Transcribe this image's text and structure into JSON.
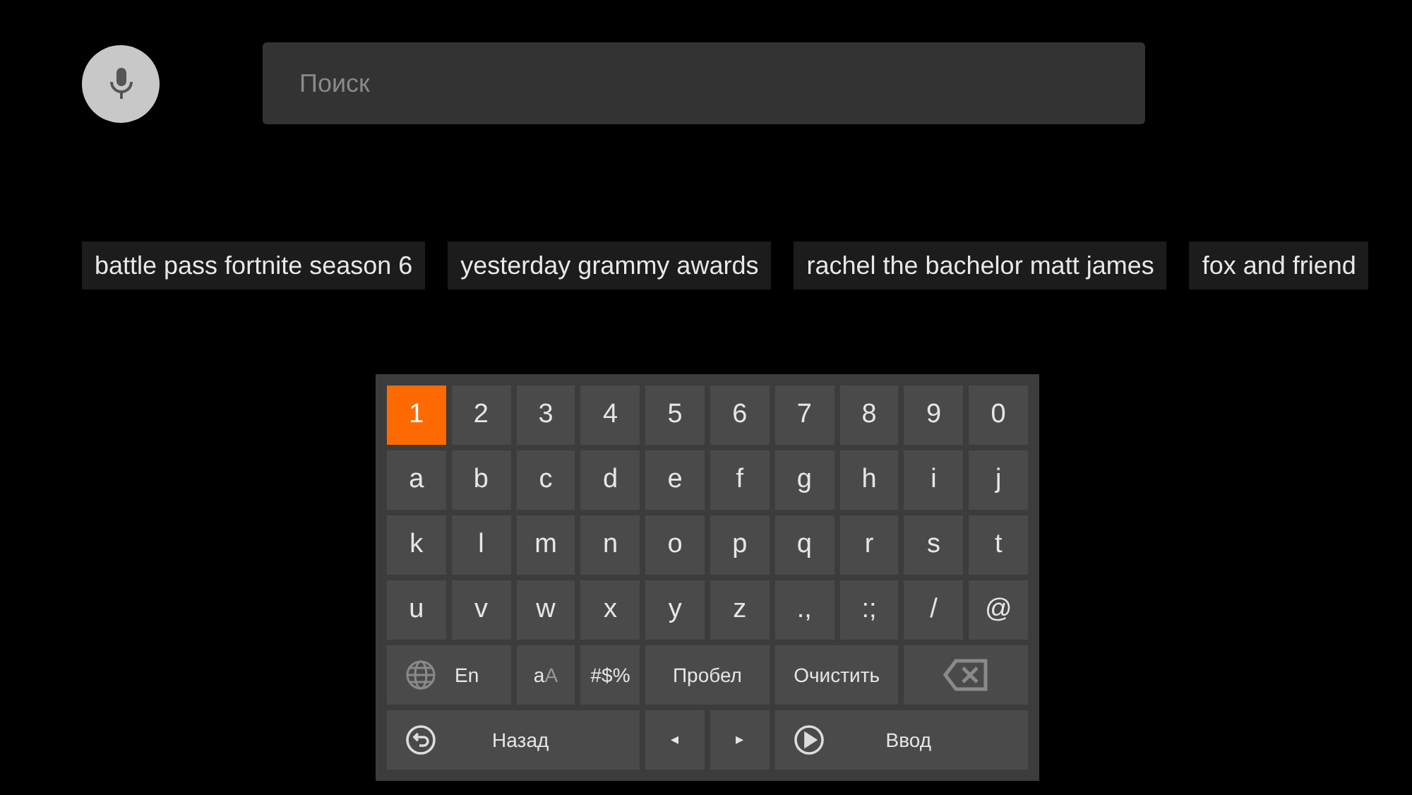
{
  "search": {
    "placeholder": "Поиск"
  },
  "suggestions": [
    "battle pass fortnite season 6",
    "yesterday grammy awards",
    "rachel the bachelor matt james",
    "fox and friend"
  ],
  "keyboard": {
    "keys": [
      {
        "kind": "char",
        "label": "1",
        "selected": true
      },
      {
        "kind": "char",
        "label": "2",
        "selected": false
      },
      {
        "kind": "char",
        "label": "3",
        "selected": false
      },
      {
        "kind": "char",
        "label": "4",
        "selected": false
      },
      {
        "kind": "char",
        "label": "5",
        "selected": false
      },
      {
        "kind": "char",
        "label": "6",
        "selected": false
      },
      {
        "kind": "char",
        "label": "7",
        "selected": false
      },
      {
        "kind": "char",
        "label": "8",
        "selected": false
      },
      {
        "kind": "char",
        "label": "9",
        "selected": false
      },
      {
        "kind": "char",
        "label": "0",
        "selected": false
      },
      {
        "kind": "char",
        "label": "a",
        "selected": false
      },
      {
        "kind": "char",
        "label": "b",
        "selected": false
      },
      {
        "kind": "char",
        "label": "c",
        "selected": false
      },
      {
        "kind": "char",
        "label": "d",
        "selected": false
      },
      {
        "kind": "char",
        "label": "e",
        "selected": false
      },
      {
        "kind": "char",
        "label": "f",
        "selected": false
      },
      {
        "kind": "char",
        "label": "g",
        "selected": false
      },
      {
        "kind": "char",
        "label": "h",
        "selected": false
      },
      {
        "kind": "char",
        "label": "i",
        "selected": false
      },
      {
        "kind": "char",
        "label": "j",
        "selected": false
      },
      {
        "kind": "char",
        "label": "k",
        "selected": false
      },
      {
        "kind": "char",
        "label": "l",
        "selected": false
      },
      {
        "kind": "char",
        "label": "m",
        "selected": false
      },
      {
        "kind": "char",
        "label": "n",
        "selected": false
      },
      {
        "kind": "char",
        "label": "o",
        "selected": false
      },
      {
        "kind": "char",
        "label": "p",
        "selected": false
      },
      {
        "kind": "char",
        "label": "q",
        "selected": false
      },
      {
        "kind": "char",
        "label": "r",
        "selected": false
      },
      {
        "kind": "char",
        "label": "s",
        "selected": false
      },
      {
        "kind": "char",
        "label": "t",
        "selected": false
      },
      {
        "kind": "char",
        "label": "u",
        "selected": false
      },
      {
        "kind": "char",
        "label": "v",
        "selected": false
      },
      {
        "kind": "char",
        "label": "w",
        "selected": false
      },
      {
        "kind": "char",
        "label": "x",
        "selected": false
      },
      {
        "kind": "char",
        "label": "y",
        "selected": false
      },
      {
        "kind": "char",
        "label": "z",
        "selected": false
      },
      {
        "kind": "char",
        "label": ".,",
        "selected": false
      },
      {
        "kind": "char",
        "label": ":;",
        "selected": false
      },
      {
        "kind": "char",
        "label": "/",
        "selected": false
      },
      {
        "kind": "char",
        "label": "@",
        "selected": false
      },
      {
        "kind": "language",
        "label": "En",
        "selected": false
      },
      {
        "kind": "case",
        "label": "a",
        "label_upper": "A",
        "selected": false
      },
      {
        "kind": "symbols",
        "label": "#$%",
        "selected": false
      },
      {
        "kind": "wide",
        "label": "Пробел",
        "selected": false
      },
      {
        "kind": "wide",
        "label": "Очистить",
        "selected": false
      },
      {
        "kind": "backspace",
        "selected": false
      },
      {
        "kind": "back",
        "label": "Назад",
        "selected": false
      },
      {
        "kind": "left",
        "label": "◂",
        "selected": false
      },
      {
        "kind": "right",
        "label": "▸",
        "selected": false
      },
      {
        "kind": "enter",
        "label": "Ввод",
        "selected": false
      }
    ]
  }
}
